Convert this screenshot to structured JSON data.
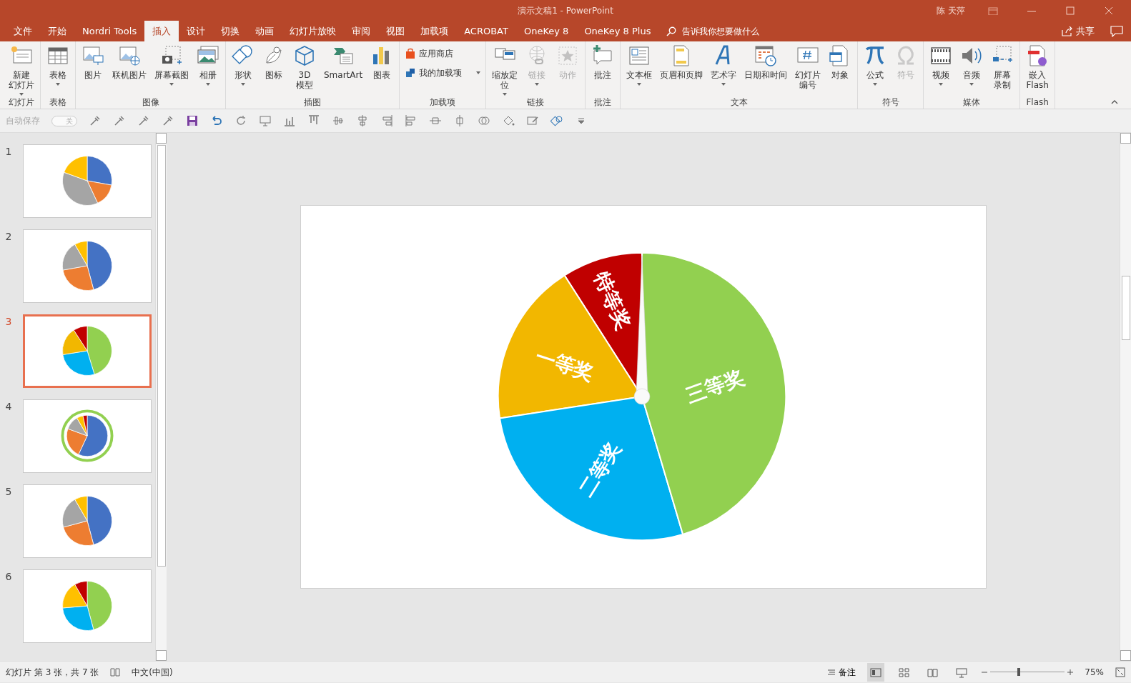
{
  "window": {
    "title": "演示文稿1  -  PowerPoint",
    "user": "陈 天萍"
  },
  "menu_tabs": [
    {
      "label": "文件",
      "selected": false
    },
    {
      "label": "开始",
      "selected": false
    },
    {
      "label": "Nordri Tools",
      "selected": false
    },
    {
      "label": "插入",
      "selected": true
    },
    {
      "label": "设计",
      "selected": false
    },
    {
      "label": "切换",
      "selected": false
    },
    {
      "label": "动画",
      "selected": false
    },
    {
      "label": "幻灯片放映",
      "selected": false
    },
    {
      "label": "审阅",
      "selected": false
    },
    {
      "label": "视图",
      "selected": false
    },
    {
      "label": "加载项",
      "selected": false
    },
    {
      "label": "ACROBAT",
      "selected": false
    },
    {
      "label": "OneKey 8",
      "selected": false
    },
    {
      "label": "OneKey 8 Plus",
      "selected": false
    }
  ],
  "tell_me": {
    "placeholder": "告诉我你想要做什么"
  },
  "share": "共享",
  "ribbon": [
    {
      "label": "幻灯片",
      "items": [
        {
          "kind": "large",
          "lines": [
            "新建",
            "幻灯片"
          ],
          "dropdown": true,
          "disabled": false
        }
      ]
    },
    {
      "label": "表格",
      "items": [
        {
          "kind": "large",
          "lines": [
            "表格"
          ],
          "dropdown": true,
          "disabled": false
        }
      ]
    },
    {
      "label": "图像",
      "items": [
        {
          "kind": "large",
          "lines": [
            "图片"
          ],
          "dropdown": false,
          "disabled": false
        },
        {
          "kind": "large",
          "lines": [
            "联机图片"
          ],
          "dropdown": false,
          "disabled": false
        },
        {
          "kind": "large",
          "lines": [
            "屏幕截图"
          ],
          "dropdown": true,
          "disabled": false
        },
        {
          "kind": "large",
          "lines": [
            "相册"
          ],
          "dropdown": true,
          "disabled": false
        }
      ]
    },
    {
      "label": "插图",
      "items": [
        {
          "kind": "large",
          "lines": [
            "形状"
          ],
          "dropdown": true,
          "disabled": false
        },
        {
          "kind": "large",
          "lines": [
            "图标"
          ],
          "dropdown": false,
          "disabled": false
        },
        {
          "kind": "large",
          "lines": [
            "3D",
            "模型"
          ],
          "dropdown": false,
          "disabled": false
        },
        {
          "kind": "large",
          "lines": [
            "SmartArt"
          ],
          "dropdown": false,
          "disabled": false
        },
        {
          "kind": "large",
          "lines": [
            "图表"
          ],
          "dropdown": false,
          "disabled": false
        }
      ]
    },
    {
      "label": "加载项",
      "items": [
        {
          "kind": "small",
          "lines": [
            "应用商店"
          ],
          "dropdown": false,
          "disabled": false
        },
        {
          "kind": "small",
          "lines": [
            "我的加载项"
          ],
          "dropdown": true,
          "disabled": false
        }
      ]
    },
    {
      "label": "链接",
      "items": [
        {
          "kind": "large",
          "lines": [
            "缩放定",
            "位"
          ],
          "dropdown": true,
          "disabled": false
        },
        {
          "kind": "large",
          "lines": [
            "链接"
          ],
          "dropdown": true,
          "disabled": true
        },
        {
          "kind": "large",
          "lines": [
            "动作"
          ],
          "dropdown": false,
          "disabled": true
        }
      ]
    },
    {
      "label": "批注",
      "items": [
        {
          "kind": "large",
          "lines": [
            "批注"
          ],
          "dropdown": false,
          "disabled": false
        }
      ]
    },
    {
      "label": "文本",
      "items": [
        {
          "kind": "large",
          "lines": [
            "文本框"
          ],
          "dropdown": true,
          "disabled": false
        },
        {
          "kind": "large",
          "lines": [
            "页眉和页脚"
          ],
          "dropdown": false,
          "disabled": false
        },
        {
          "kind": "large",
          "lines": [
            "艺术字"
          ],
          "dropdown": true,
          "disabled": false
        },
        {
          "kind": "large",
          "lines": [
            "日期和时间"
          ],
          "dropdown": false,
          "disabled": false
        },
        {
          "kind": "large",
          "lines": [
            "幻灯片",
            "编号"
          ],
          "dropdown": false,
          "disabled": false
        },
        {
          "kind": "large",
          "lines": [
            "对象"
          ],
          "dropdown": false,
          "disabled": false
        }
      ]
    },
    {
      "label": "符号",
      "items": [
        {
          "kind": "large",
          "lines": [
            "公式"
          ],
          "dropdown": true,
          "disabled": false
        },
        {
          "kind": "large",
          "lines": [
            "符号"
          ],
          "dropdown": false,
          "disabled": true
        }
      ]
    },
    {
      "label": "媒体",
      "items": [
        {
          "kind": "large",
          "lines": [
            "视频"
          ],
          "dropdown": true,
          "disabled": false
        },
        {
          "kind": "large",
          "lines": [
            "音频"
          ],
          "dropdown": true,
          "disabled": false
        },
        {
          "kind": "large",
          "lines": [
            "屏幕",
            "录制"
          ],
          "dropdown": false,
          "disabled": false
        }
      ]
    },
    {
      "label": "Flash",
      "items": [
        {
          "kind": "large",
          "lines": [
            "嵌入",
            "Flash"
          ],
          "dropdown": false,
          "disabled": false
        }
      ]
    }
  ],
  "quick_access": {
    "autosave_label": "自动保存",
    "autosave_toggle": "关",
    "autosave_on": false
  },
  "slides": [
    {
      "number": "1",
      "selected": false
    },
    {
      "number": "2",
      "selected": false
    },
    {
      "number": "3",
      "selected": true
    },
    {
      "number": "4",
      "selected": false
    },
    {
      "number": "5",
      "selected": false
    },
    {
      "number": "6",
      "selected": false
    }
  ],
  "wheel": {
    "labels": [
      {
        "text": "特等奖",
        "color": "#c00000"
      },
      {
        "text": "一等奖",
        "color": "#f2b700"
      },
      {
        "text": "二等奖",
        "color": "#00b0f0"
      },
      {
        "text": "三等奖",
        "color": "#92d050"
      }
    ]
  },
  "status_bar": {
    "slide_counter": "幻灯片 第 3 张，共 7 张",
    "language": "中文(中国)",
    "notes": "备注",
    "zoom": {
      "level": 0.38,
      "reading": "75%"
    }
  }
}
